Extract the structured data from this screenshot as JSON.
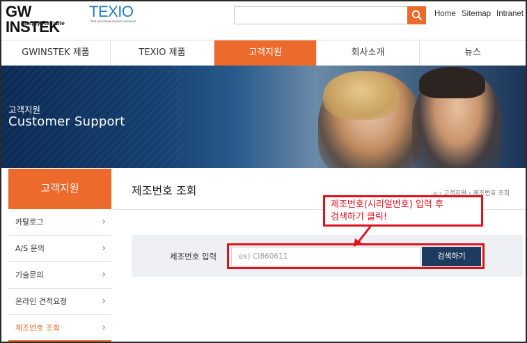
{
  "header": {
    "gwinstek_brand": "GW INSTEK",
    "gwinstek_tagline": "Simply Reliable",
    "texio_brand": "TEXIO",
    "texio_tagline": "Test and Measurement Solutions",
    "search_placeholder": "",
    "links": [
      "Home",
      "Sitemap",
      "Intranet"
    ]
  },
  "nav": {
    "items": [
      "GWINSTEK 제품",
      "TEXIO 제품",
      "고객지원",
      "회사소개",
      "뉴스"
    ],
    "active": "고객지원"
  },
  "banner": {
    "subtitle": "고객지원",
    "title": "Customer Support"
  },
  "sidebar": {
    "heading": "고객지원",
    "items": [
      {
        "label": "카탈로그"
      },
      {
        "label": "A/S 문의"
      },
      {
        "label": "기술문의"
      },
      {
        "label": "온라인 견적요청"
      },
      {
        "label": "제조번호 조회",
        "active": true
      }
    ]
  },
  "main": {
    "page_title": "제조번호 조회",
    "breadcrumb": [
      "고객지원",
      "제조번호 조회"
    ],
    "form": {
      "label": "제조번호 입력",
      "placeholder": "ex) CI860611",
      "button": "검색하기"
    },
    "callout": {
      "line1": "제조번호(시리얼번호) 입력 후",
      "line2": "검색하기 클릭!"
    }
  },
  "colors": {
    "accent": "#ec6a2b",
    "button_navy": "#1f3a5f",
    "annotation_red": "#e3101a"
  }
}
